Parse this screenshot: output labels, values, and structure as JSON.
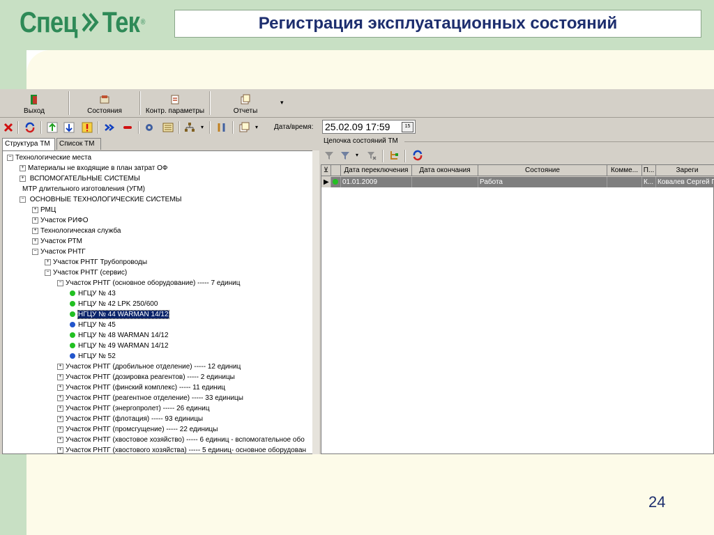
{
  "slide": {
    "logo_text_left": "Спец",
    "logo_text_right": "Тек",
    "logo_reg": "®",
    "title": "Регистрация эксплуатационных состояний",
    "page_number": "24",
    "colors": {
      "green_band": "#c8e0c4",
      "cream": "#fdfbe9",
      "title": "#1d2e6e",
      "logo": "#2e8a57"
    }
  },
  "toolbar": {
    "buttons": [
      {
        "label": "Выход",
        "icon": "exit-door-icon"
      },
      {
        "label": "Состояния",
        "icon": "states-icon"
      },
      {
        "label": "Контр. параметры",
        "icon": "control-params-icon"
      },
      {
        "label": "Отчеты",
        "icon": "reports-icon"
      }
    ],
    "more": "▾"
  },
  "toolbar2": {
    "datetime_label": "Дата/время:",
    "datetime_value": "25.02.09 17:59",
    "calendar_glyph": "15"
  },
  "tabs": [
    {
      "label": "Структура ТМ",
      "active": true
    },
    {
      "label": "Список ТМ",
      "active": false
    }
  ],
  "tree": {
    "rows": [
      {
        "text": "Технологические места",
        "level": 0,
        "exp": "−"
      },
      {
        "text": "Материалы не входящие в план затрат ОФ",
        "level": 1,
        "exp": "+"
      },
      {
        "text": " ВСПОМОГАТЕЛЬНЫЕ СИСТЕМЫ",
        "level": 1,
        "exp": "+"
      },
      {
        "text": "МТР длительного изготовления (УГМ)",
        "level": 1,
        "exp": ""
      },
      {
        "text": " ОСНОВНЫЕ ТЕХНОЛОГИЧЕСКИЕ СИСТЕМЫ",
        "level": 1,
        "exp": "−"
      },
      {
        "text": "РМЦ",
        "level": 2,
        "exp": "+"
      },
      {
        "text": "Участок РИФО",
        "level": 2,
        "exp": "+"
      },
      {
        "text": "Технологическая служба",
        "level": 2,
        "exp": "+"
      },
      {
        "text": "Участок РТМ",
        "level": 2,
        "exp": "+"
      },
      {
        "text": "Участок РНТГ",
        "level": 2,
        "exp": "−"
      },
      {
        "text": "Участок РНТГ Трубопроводы",
        "level": 3,
        "exp": "+"
      },
      {
        "text": "Участок РНТГ (сервис)",
        "level": 3,
        "exp": "−"
      },
      {
        "text": "Участок РНТГ (основное оборудование) ----- 7 единиц",
        "level": 4,
        "exp": "−"
      },
      {
        "text": "НГЦУ № 43",
        "level": 5,
        "dot": "#22c022"
      },
      {
        "text": "НГЦУ № 42 LPK 250/600",
        "level": 5,
        "dot": "#22c022"
      },
      {
        "text": "НГЦУ № 44 WARMAN 14/12",
        "level": 5,
        "dot": "#22c022",
        "selected": true
      },
      {
        "text": "НГЦУ № 45",
        "level": 5,
        "dot": "#2255cc"
      },
      {
        "text": "НГЦУ № 48 WARMAN 14/12",
        "level": 5,
        "dot": "#22c022"
      },
      {
        "text": "НГЦУ № 49 WARMAN 14/12",
        "level": 5,
        "dot": "#22c022"
      },
      {
        "text": "НГЦУ № 52",
        "level": 5,
        "dot": "#2255cc"
      },
      {
        "text": "Участок РНТГ (дробильное отделение) ----- 12 единиц",
        "level": 4,
        "exp": "+"
      },
      {
        "text": "Участок РНТГ (дозировка реагентов) ----- 2 единицы",
        "level": 4,
        "exp": "+"
      },
      {
        "text": "Участок РНТГ (финский комплекс) ----- 11 единиц",
        "level": 4,
        "exp": "+"
      },
      {
        "text": "Участок РНТГ (реагентное отделение) ----- 33 единицы",
        "level": 4,
        "exp": "+"
      },
      {
        "text": "Участок РНТГ (энергопролет) ----- 26 единиц",
        "level": 4,
        "exp": "+"
      },
      {
        "text": "Участок РНТГ (флотация) ----- 93 единицы",
        "level": 4,
        "exp": "+"
      },
      {
        "text": "Участок РНТГ (промсгущение) ----- 22 единицы",
        "level": 4,
        "exp": "+"
      },
      {
        "text": "Участок РНТГ (хвостовое хозяйство) ----- 6 единиц - вспомогательное обо",
        "level": 4,
        "exp": "+"
      },
      {
        "text": "Участок РНТГ (хвостового хозяйства) ----- 5 единиц- основное оборудован",
        "level": 4,
        "exp": "+"
      }
    ]
  },
  "chain": {
    "label": "Цепочка состояний ТМ",
    "columns": [
      "Дата переключения",
      "Дата окончания",
      "Состояние",
      "Комме...",
      "П...",
      "Зареги"
    ],
    "rows": [
      {
        "date_switch": "01.01.2009",
        "date_end": "",
        "state": "Работа",
        "comment": "",
        "p": "К...",
        "registered": "Ковалев Сергей Г"
      }
    ]
  }
}
